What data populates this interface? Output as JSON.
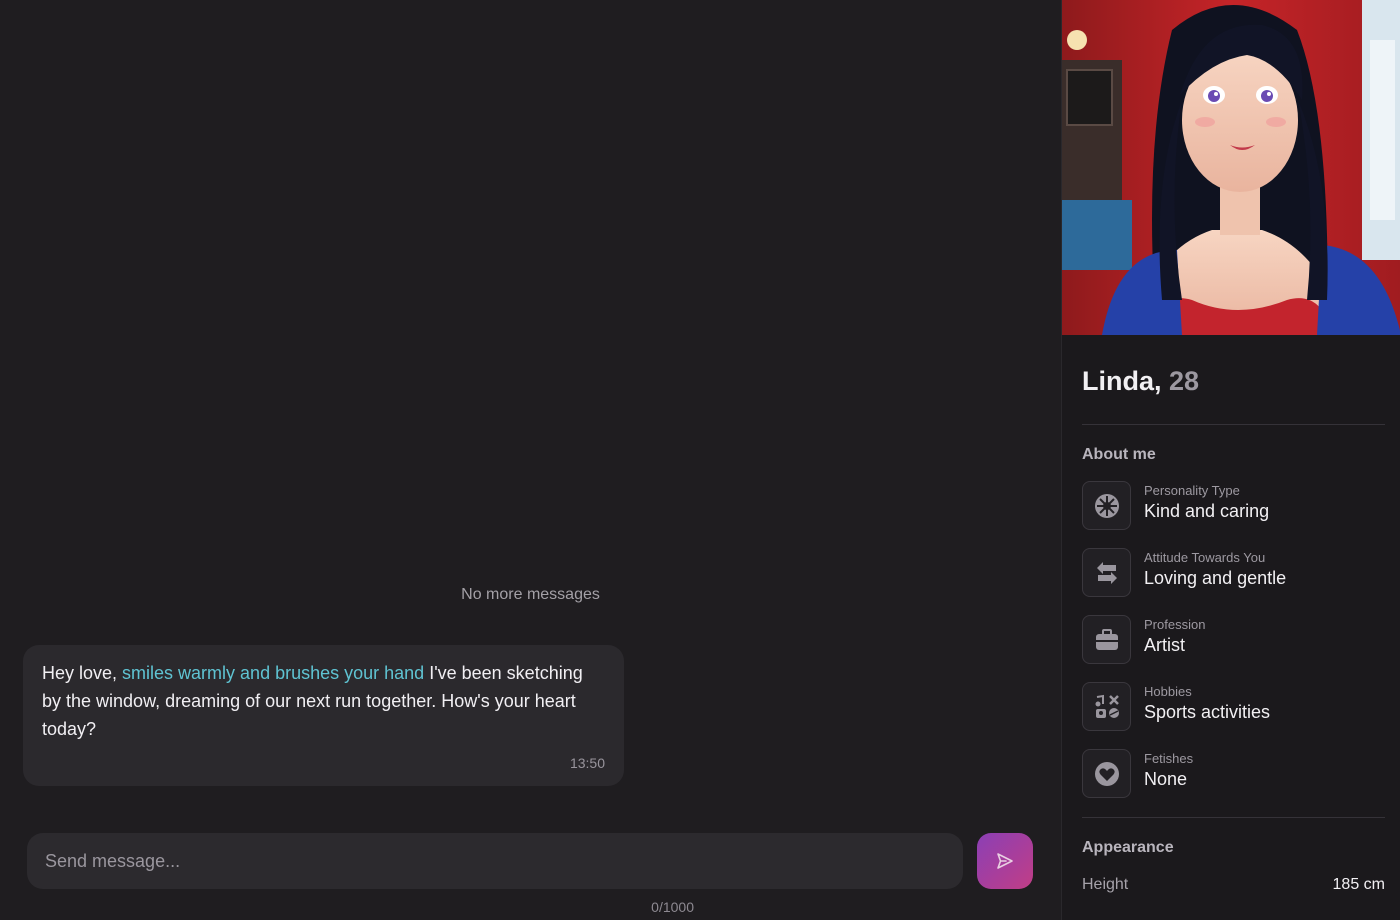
{
  "chat": {
    "no_more": "No more messages",
    "message": {
      "text_before": "Hey love, ",
      "action": "smiles warmly and brushes your hand",
      "text_after": " I've been sketching by the window, dreaming of our next run together. How's your heart today?",
      "time": "13:50"
    },
    "composer": {
      "placeholder": "Send message...",
      "value": "",
      "counter": "0/1000"
    },
    "send_icon": "send-icon",
    "accent_gradient": [
      "#8b3fb5",
      "#c13e86"
    ],
    "action_color": "#5fc3d2"
  },
  "profile": {
    "name": "Linda,",
    "age": "28",
    "about_title": "About me",
    "traits": [
      {
        "label": "Personality Type",
        "value": "Kind and caring",
        "icon": "personality-icon"
      },
      {
        "label": "Attitude Towards You",
        "value": "Loving and gentle",
        "icon": "arrows-swap-icon"
      },
      {
        "label": "Profession",
        "value": "Artist",
        "icon": "briefcase-icon"
      },
      {
        "label": "Hobbies",
        "value": "Sports activities",
        "icon": "hobbies-icon"
      },
      {
        "label": "Fetishes",
        "value": "None",
        "icon": "heart-icon"
      }
    ],
    "appearance_title": "Appearance",
    "appearance": [
      {
        "label": "Height",
        "value": "185 cm"
      }
    ]
  }
}
